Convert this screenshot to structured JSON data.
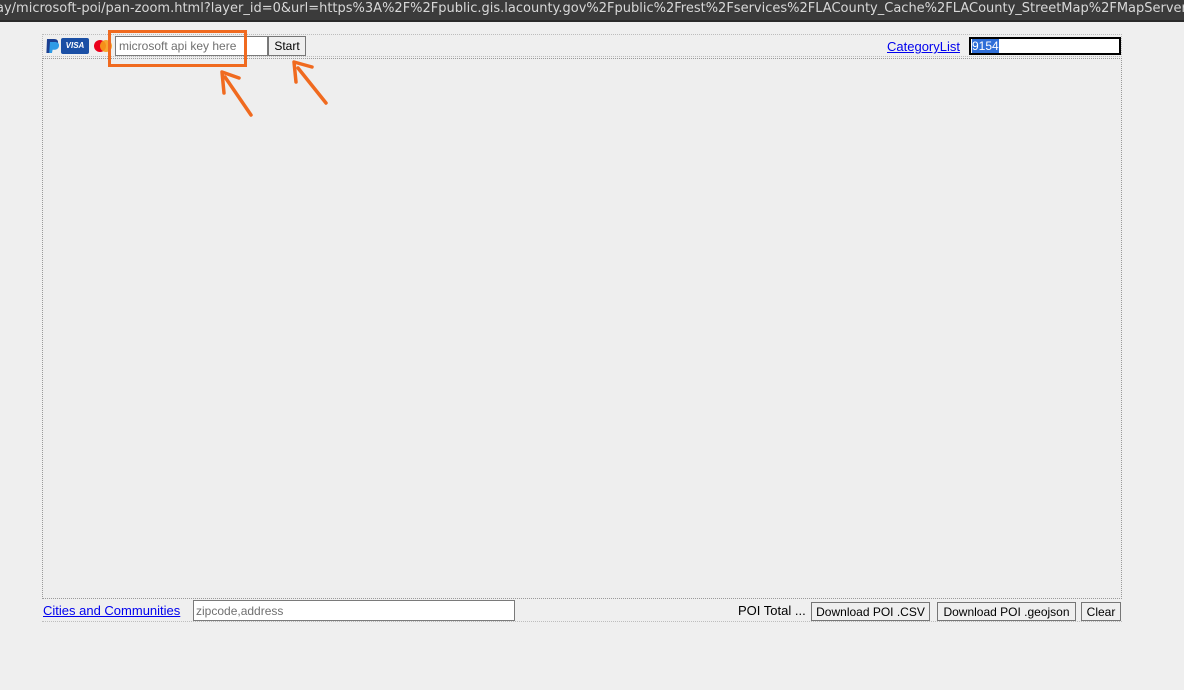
{
  "browser": {
    "url": "ay/microsoft-poi/pan-zoom.html?layer_id=0&url=https%3A%2F%2Fpublic.gis.lacounty.gov%2Fpublic%2Frest%2Fservices%2FLACounty_Cache%2FLACounty_StreetMap%2FMapServer&poicate"
  },
  "toolbar": {
    "payment_icons": [
      "paypal-icon",
      "visa-icon",
      "mastercard-icon"
    ],
    "visa_label": "VISA",
    "api_key_placeholder": "microsoft api key here",
    "start_label": "Start",
    "category_link": "CategoryList",
    "category_value": "9154"
  },
  "footer": {
    "cities_link": "Cities and Communities",
    "zip_placeholder": "zipcode,address",
    "poi_total": "POI Total ...",
    "download_csv": "Download POI .CSV",
    "download_geojson": "Download POI .geojson",
    "clear": "Clear"
  },
  "annotation": {
    "color": "#f06a1f"
  }
}
